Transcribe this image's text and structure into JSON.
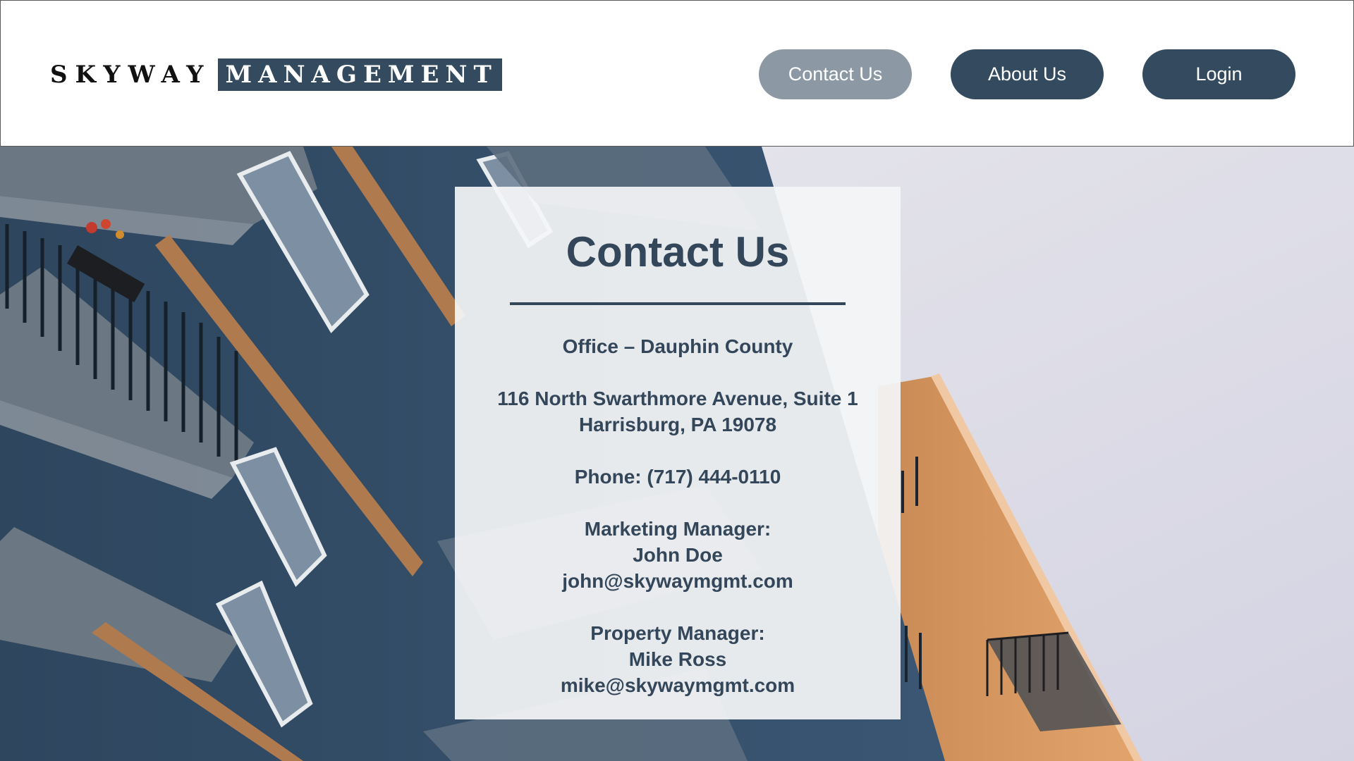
{
  "header": {
    "logo_word1": "SKYWAY",
    "logo_word2": "MANAGEMENT",
    "nav": {
      "contact_label": "Contact Us",
      "about_label": "About Us",
      "login_label": "Login"
    }
  },
  "card": {
    "title": "Contact Us",
    "office": "Office – Dauphin County",
    "address_line1": "116 North Swarthmore Avenue, Suite 1",
    "address_line2": "Harrisburg, PA 19078",
    "phone": "Phone: (717) 444-0110",
    "marketing": {
      "role": "Marketing Manager:",
      "name": "John Doe",
      "email": "john@skywaymgmt.com"
    },
    "property": {
      "role": "Property Manager:",
      "name": "Mike Ross",
      "email": "mike@skywaymgmt.com"
    }
  },
  "colors": {
    "brand_navy": "#344a5e",
    "nav_active": "#8c99a4",
    "text_dark": "#34465a"
  }
}
